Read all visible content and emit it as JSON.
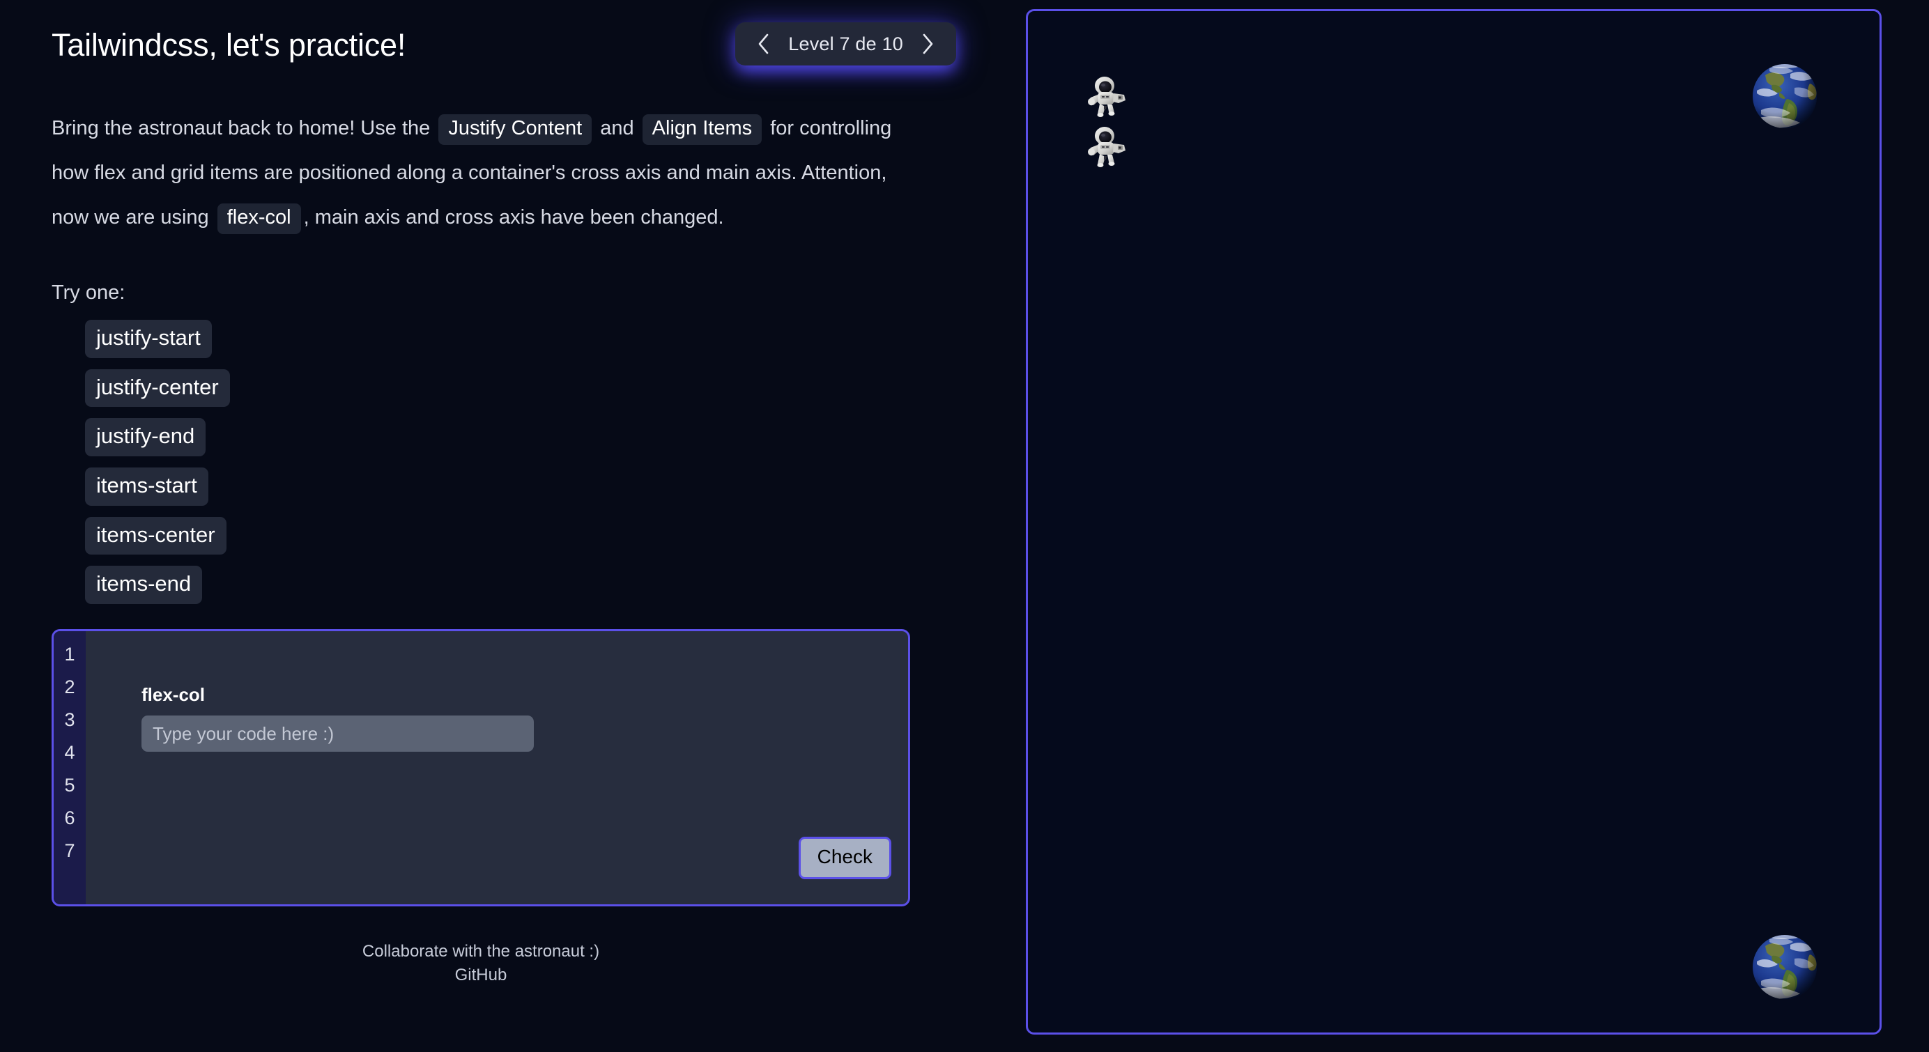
{
  "header": {
    "title": "Tailwindcss, let's practice!",
    "level_nav": {
      "prev_icon": "chevron-left-icon",
      "next_icon": "chevron-right-icon",
      "label": "Level 7 de 10",
      "current_level": 7,
      "total_levels": 10
    }
  },
  "description": {
    "part1": "Bring the astronaut back to home! Use the",
    "chip1": "Justify Content",
    "part2": "and",
    "chip2": "Align Items",
    "part3": "for controlling how flex and grid items are positioned along a container's cross axis and main axis. Attention, now we are using",
    "chip3": "flex-col",
    "part4": ", main axis and cross axis have been changed."
  },
  "try_one_label": "Try one:",
  "options": [
    {
      "label": "justify-start"
    },
    {
      "label": "justify-center"
    },
    {
      "label": "justify-end"
    },
    {
      "label": "items-start"
    },
    {
      "label": "items-center"
    },
    {
      "label": "items-end"
    }
  ],
  "editor": {
    "line_numbers": [
      "1",
      "2",
      "3",
      "4",
      "5",
      "6",
      "7"
    ],
    "applied_class": "flex-col",
    "input_value": "",
    "input_placeholder": "Type your code here :)",
    "check_label": "Check"
  },
  "footer": {
    "collaborate_text": "Collaborate with the astronaut :)",
    "github_label": "GitHub"
  },
  "game": {
    "astronauts": [
      {
        "name": "astronaut-1"
      },
      {
        "name": "astronaut-2"
      }
    ],
    "earths": [
      {
        "name": "earth-top-right"
      },
      {
        "name": "earth-bottom-right"
      }
    ]
  },
  "colors": {
    "page_background": "#060a17",
    "accent_border": "#5b50e8",
    "chip_background": "#1e2433",
    "option_chip_background": "#242a3a",
    "editor_background": "#272d3e",
    "gutter_background": "#1b1b4a",
    "input_background": "#5b6374",
    "check_button_background": "#a7b0c4",
    "level_pill_background": "#232838"
  }
}
